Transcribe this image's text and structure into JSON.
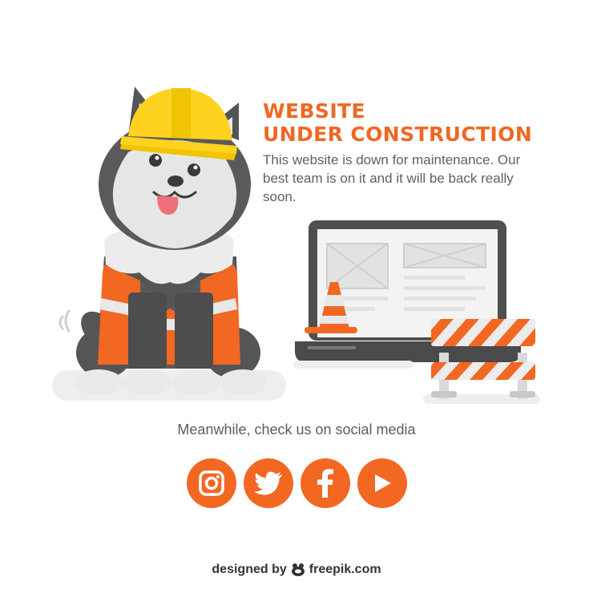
{
  "headline": {
    "line1": "WEBSITE",
    "line2": "UNDER CONSTRUCTION"
  },
  "description": "This website is down for maintenance. Our best team is on it and it will be back really soon.",
  "social": {
    "caption": "Meanwhile, check us on social media",
    "buttons": [
      {
        "icon": "instagram-icon"
      },
      {
        "icon": "twitter-icon"
      },
      {
        "icon": "facebook-icon"
      },
      {
        "icon": "youtube-play-icon"
      }
    ]
  },
  "credit": {
    "prefix": "designed by",
    "brand": "freepik.com"
  },
  "colors": {
    "accent": "#f26722",
    "helmet": "#ffd21f",
    "dark_gray": "#555555",
    "light_gray": "#e8e8e8",
    "text": "#606060"
  }
}
